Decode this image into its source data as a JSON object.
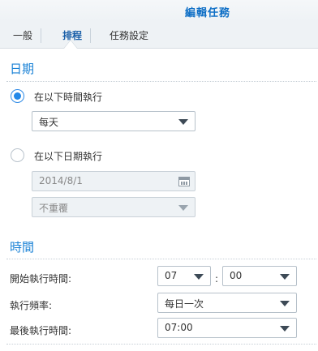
{
  "window": {
    "title": "編輯任務"
  },
  "tabs": [
    {
      "label": "一般"
    },
    {
      "label": "排程"
    },
    {
      "label": "任務設定"
    }
  ],
  "date_section": {
    "title": "日期",
    "run_on_following_days": {
      "label": "在以下時間執行",
      "selected": true,
      "value": "每天"
    },
    "run_on_following_date": {
      "label": "在以下日期執行",
      "selected": false,
      "date": "2014/8/1",
      "repeat": "不重覆"
    }
  },
  "time_section": {
    "title": "時間",
    "start_time_label": "開始執行時間:",
    "start_hour": "07",
    "colon": ":",
    "start_minute": "00",
    "frequency_label": "執行頻率:",
    "frequency_value": "每日一次",
    "last_run_label": "最後執行時間:",
    "last_run_value": "07:00"
  }
}
